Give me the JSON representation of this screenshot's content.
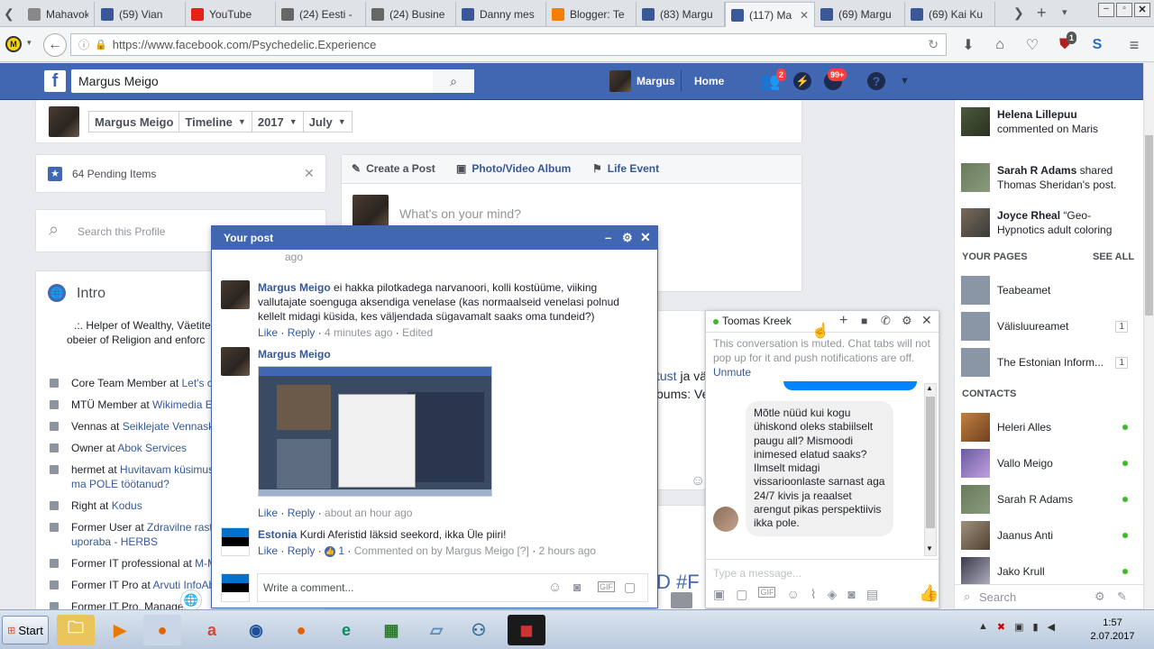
{
  "browser": {
    "tabs": [
      {
        "label": "Mahavok -",
        "icon": "gear-icon",
        "color": "#888888"
      },
      {
        "label": "(59) Vian",
        "icon": "facebook-icon",
        "color": "#3b5998"
      },
      {
        "label": "YouTube",
        "icon": "youtube-icon",
        "color": "#e62117"
      },
      {
        "label": "(24) Eesti -",
        "icon": "page-icon",
        "color": "#666666"
      },
      {
        "label": "(24) Busine",
        "icon": "page-icon",
        "color": "#666666"
      },
      {
        "label": "Danny mes",
        "icon": "facebook-icon",
        "color": "#3b5998"
      },
      {
        "label": "Blogger: Te",
        "icon": "blogger-icon",
        "color": "#f57d00"
      },
      {
        "label": "(83) Margu",
        "icon": "facebook-icon",
        "color": "#3b5998"
      },
      {
        "label": "(117) Ma",
        "icon": "facebook-icon",
        "color": "#3b5998"
      },
      {
        "label": "(69) Margu",
        "icon": "facebook-icon",
        "color": "#3b5998"
      },
      {
        "label": "(69) Kai Ku",
        "icon": "facebook-icon",
        "color": "#3b5998"
      }
    ],
    "url": "https://www.facebook.com/Psychedelic.Experience",
    "addon_badge": "1"
  },
  "fb": {
    "search_value": "Margus Meigo",
    "user_name": "Margus",
    "home": "Home",
    "friends_badge": "2",
    "notif_badge": "99+"
  },
  "timeline": {
    "name": "Margus Meigo",
    "timeline": "Timeline",
    "year": "2017",
    "month": "July"
  },
  "pending": "64 Pending Items",
  "search_profile": "Search this Profile",
  "composer": {
    "create_post": "Create a Post",
    "album": "Photo/Video Album",
    "life_event": "Life Event",
    "placeholder": "What's on your mind?"
  },
  "intro": {
    "title": "Intro",
    "bio": ".:. Helper of Wealthy, Väetiteg... obeier of Religion and enforc...",
    "bio_line1": ".:. Helper of Wealthy, Väetiteg",
    "bio_line2": "obeier of Religion and enforc",
    "items": [
      {
        "prefix": "Core Team Member at",
        "link": "Let's c"
      },
      {
        "prefix": "MTÜ Member at",
        "link": "Wikimedia E"
      },
      {
        "prefix": "Vennas at",
        "link": "Seiklejate Vennask"
      },
      {
        "prefix": "Owner at",
        "link": "Abok Services"
      },
      {
        "prefix": "hermet at",
        "link": "Huvitavam küsimus",
        "link2": "ma POLE töötanud?"
      },
      {
        "prefix": "Right at",
        "link": "Kodus"
      },
      {
        "prefix": "Former User at",
        "link": "Zdravilne rast",
        "link2": "uporaba - HERBS"
      },
      {
        "prefix": "Former IT professional at",
        "link": "M-M"
      },
      {
        "prefix": "Former IT Pro at",
        "link": "Arvuti InfoAb"
      },
      {
        "prefix": "Former IT Pro, Manage",
        "link": ""
      }
    ]
  },
  "behind_post": {
    "text_link": "tust",
    "text_after": " ja vä",
    "text2": "bums: Ve"
  },
  "popup": {
    "title": "Your post",
    "top_time": "ago",
    "comments": [
      {
        "author": "Margus Meigo",
        "text": "ei hakka pilotkadega narvanoori, kolli kostüüme, viiking vallutajate soenguga aksendiga venelase (kas normaalseid venelasi polnud kellelt midagi küsida, kes väljendada sügavamalt saaks oma tundeid?)",
        "like": "Like",
        "reply": "Reply",
        "time": "4 minutes ago",
        "edited": "Edited"
      },
      {
        "author": "Margus Meigo",
        "like": "Like",
        "reply": "Reply",
        "time": "about an hour ago"
      },
      {
        "author": "Estonia",
        "text": "Kurdi Aferistid läksid seekord, ikka Üle piiri!",
        "like": "Like",
        "reply": "Reply",
        "reactions": "1",
        "commented_by": "Commented on by Margus Meigo",
        "help": "[?]",
        "time": "2 hours ago"
      }
    ],
    "write_placeholder": "Write a comment..."
  },
  "chat": {
    "name": "Toomas Kreek",
    "muted_text": "This conversation is muted. Chat tabs will not pop up for it and push notifications are off.",
    "unmute": "Unmute",
    "message": "Mõtle nüüd kui kogu ühiskond oleks stabiilselt paugu all? Mismoodi inimesed elatud saaks? Ilmselt midagi vissarioonlaste sarnast aga 24/7 kivis ja reaalset arengut pikas perspektiivis ikka pole.",
    "input_placeholder": "Type a message..."
  },
  "rail": {
    "activity": [
      {
        "name": "Helena Lillepuu",
        "text": "commented on Maris Hansalu's post."
      },
      {
        "name": "Sarah R Adams",
        "text": "shared Thomas Sheridan's post."
      },
      {
        "name": "Joyce Rheal",
        "text": "“Geo-Hypnotics adult coloring"
      }
    ],
    "your_pages": "YOUR PAGES",
    "see_all": "SEE ALL",
    "pages": [
      {
        "name": "Teabeamet",
        "count": ""
      },
      {
        "name": "Välisluureamet",
        "count": "1"
      },
      {
        "name": "The Estonian Inform...",
        "count": "1"
      }
    ],
    "contacts_title": "CONTACTS",
    "contacts": [
      "Heleri Alles",
      "Vallo Meigo",
      "Sarah R Adams",
      "Jaanus Anti",
      "Jako Krull"
    ],
    "search": "Search"
  },
  "taskbar": {
    "start": "Start",
    "time": "1:57",
    "date": "2.07.2017"
  }
}
